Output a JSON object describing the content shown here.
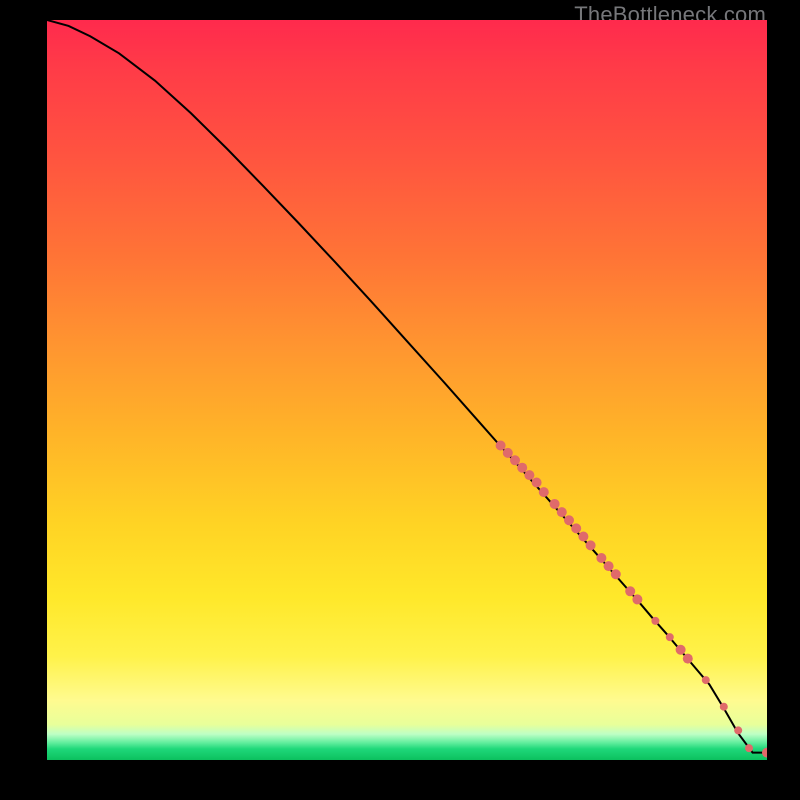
{
  "watermark_text": "TheBottleneck.com",
  "chart_data": {
    "type": "line",
    "title": "",
    "xlabel": "",
    "ylabel": "",
    "xlim": [
      0,
      100
    ],
    "ylim": [
      0,
      100
    ],
    "grid": false,
    "legend": false,
    "line": {
      "x": [
        0,
        3,
        6,
        10,
        15,
        20,
        25,
        30,
        35,
        40,
        45,
        50,
        55,
        60,
        63,
        65,
        68,
        70,
        72,
        74,
        76,
        78,
        80,
        82,
        84,
        86,
        88,
        90,
        92,
        94,
        96,
        98,
        100
      ],
      "y": [
        100,
        99.2,
        97.8,
        95.5,
        91.8,
        87.4,
        82.6,
        77.6,
        72.5,
        67.3,
        62.0,
        56.6,
        51.2,
        45.7,
        42.4,
        40.3,
        37.0,
        34.8,
        32.6,
        30.4,
        28.2,
        26.0,
        23.8,
        21.6,
        19.3,
        17.1,
        14.8,
        12.5,
        10.2,
        7.0,
        3.6,
        1.0,
        1.0
      ]
    },
    "markers": [
      {
        "x": 63.0,
        "y": 42.5,
        "r": 5
      },
      {
        "x": 64.0,
        "y": 41.5,
        "r": 5
      },
      {
        "x": 65.0,
        "y": 40.5,
        "r": 5
      },
      {
        "x": 66.0,
        "y": 39.5,
        "r": 5
      },
      {
        "x": 67.0,
        "y": 38.5,
        "r": 5
      },
      {
        "x": 68.0,
        "y": 37.5,
        "r": 5
      },
      {
        "x": 69.0,
        "y": 36.2,
        "r": 5
      },
      {
        "x": 70.5,
        "y": 34.6,
        "r": 5
      },
      {
        "x": 71.5,
        "y": 33.5,
        "r": 5
      },
      {
        "x": 72.5,
        "y": 32.4,
        "r": 5
      },
      {
        "x": 73.5,
        "y": 31.3,
        "r": 5
      },
      {
        "x": 74.5,
        "y": 30.2,
        "r": 5
      },
      {
        "x": 75.5,
        "y": 29.0,
        "r": 5
      },
      {
        "x": 77.0,
        "y": 27.3,
        "r": 5
      },
      {
        "x": 78.0,
        "y": 26.2,
        "r": 5
      },
      {
        "x": 79.0,
        "y": 25.1,
        "r": 5
      },
      {
        "x": 81.0,
        "y": 22.8,
        "r": 5
      },
      {
        "x": 82.0,
        "y": 21.7,
        "r": 5
      },
      {
        "x": 84.5,
        "y": 18.8,
        "r": 4
      },
      {
        "x": 86.5,
        "y": 16.6,
        "r": 4
      },
      {
        "x": 88.0,
        "y": 14.9,
        "r": 5
      },
      {
        "x": 89.0,
        "y": 13.7,
        "r": 5
      },
      {
        "x": 91.5,
        "y": 10.8,
        "r": 4
      },
      {
        "x": 94.0,
        "y": 7.2,
        "r": 4
      },
      {
        "x": 96.0,
        "y": 4.0,
        "r": 4
      },
      {
        "x": 97.5,
        "y": 1.6,
        "r": 4
      },
      {
        "x": 100.0,
        "y": 1.0,
        "r": 5
      }
    ],
    "marker_color": "#e06a6a",
    "line_color": "#000000"
  }
}
